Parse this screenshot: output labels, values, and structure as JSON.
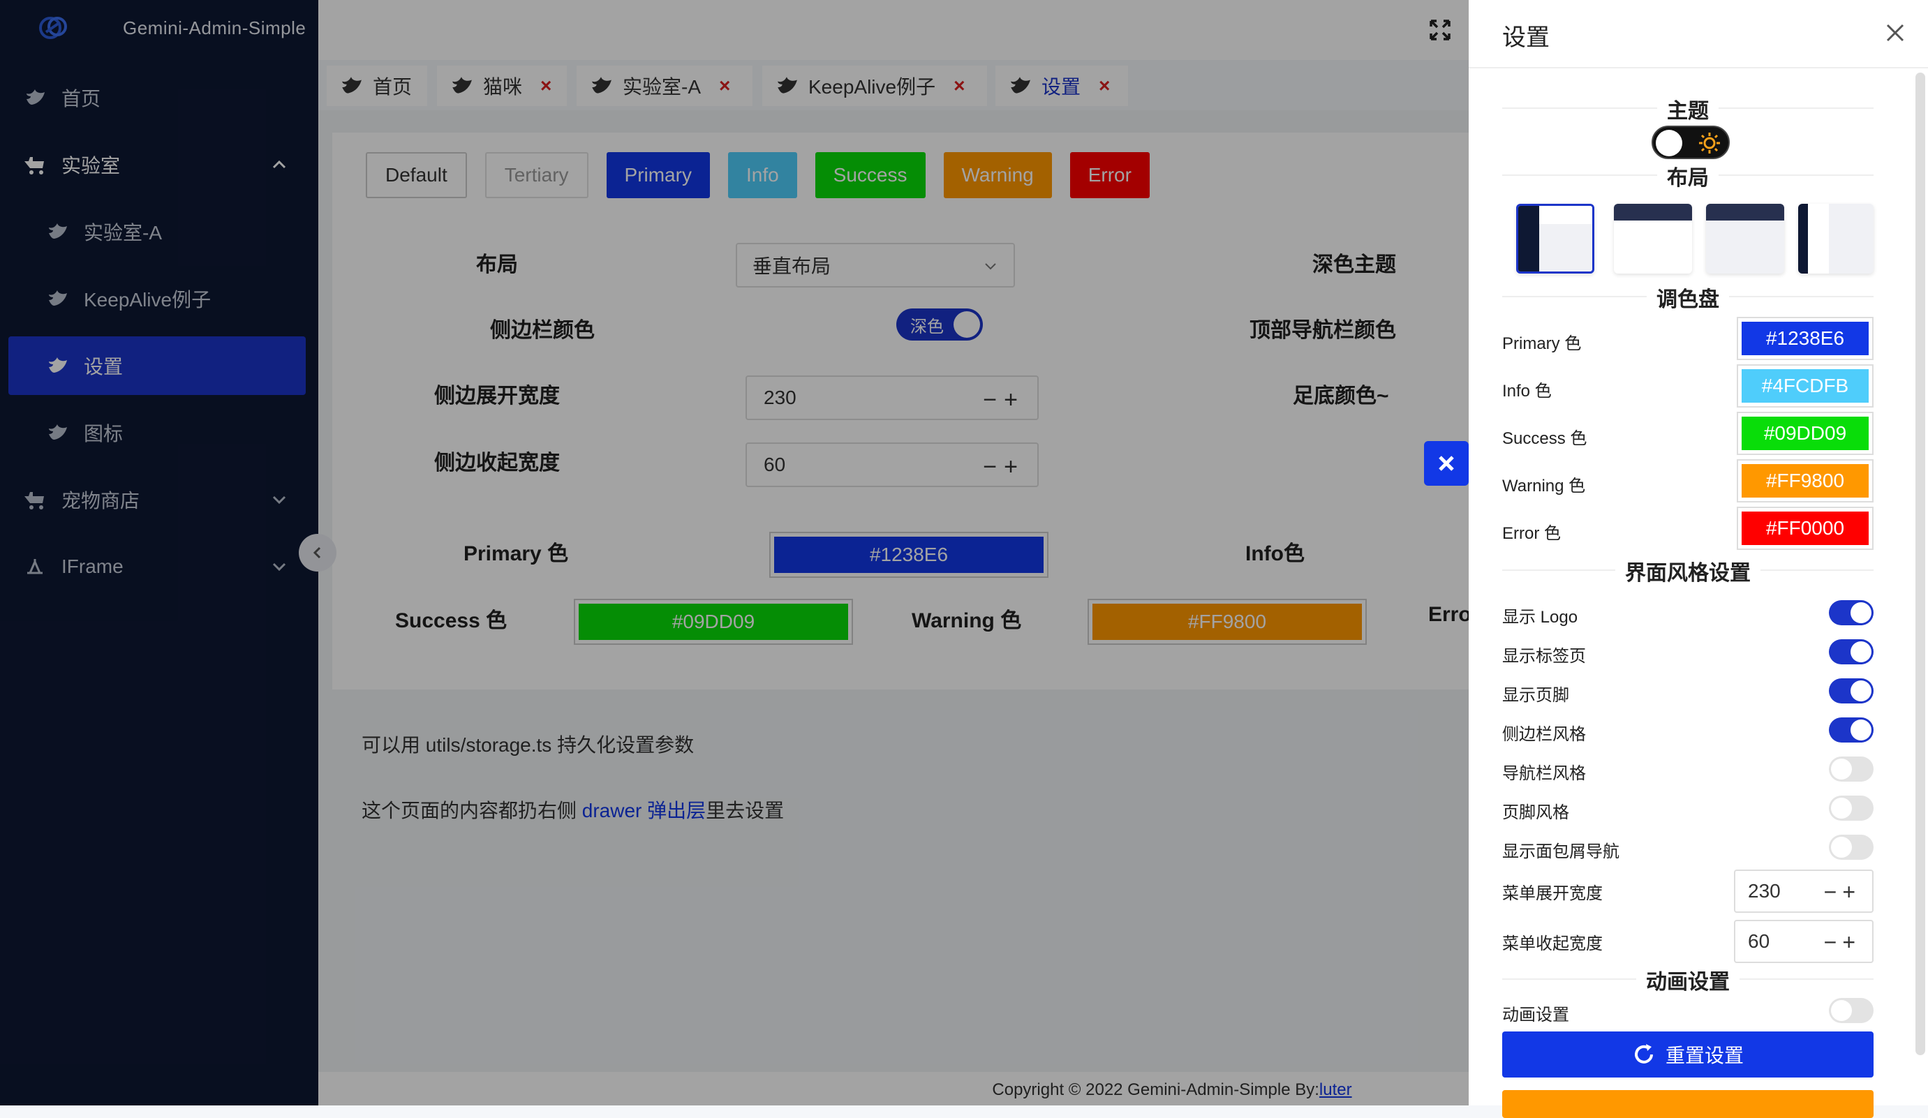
{
  "app": {
    "title": "Gemini-Admin-Simple"
  },
  "sidebar": {
    "items": [
      {
        "label": "首页"
      },
      {
        "label": "实验室"
      },
      {
        "label": "实验室-A"
      },
      {
        "label": "KeepAlive例子"
      },
      {
        "label": "设置"
      },
      {
        "label": "图标"
      },
      {
        "label": "宠物商店"
      },
      {
        "label": "IFrame"
      }
    ]
  },
  "tabs": [
    {
      "label": "首页"
    },
    {
      "label": "猫咪",
      "close": "×"
    },
    {
      "label": "实验室-A",
      "close": "×"
    },
    {
      "label": "KeepAlive例子",
      "close": "×"
    },
    {
      "label": "设置",
      "close": "×"
    }
  ],
  "buttons": [
    "Default",
    "Tertiary",
    "Primary",
    "Info",
    "Success",
    "Warning",
    "Error"
  ],
  "form": {
    "layout_label": "布局",
    "layout_value": "垂直布局",
    "dark_theme_label": "深色主题",
    "sidebar_color_label": "侧边栏颜色",
    "sidebar_color_switch": "深色",
    "topnav_color_label": "顶部导航栏颜色",
    "sidebar_expand_label": "侧边展开宽度",
    "sidebar_expand_value": "230",
    "footer_color_label": "足底颜色~",
    "sidebar_collapse_label": "侧边收起宽度",
    "sidebar_collapse_value": "60"
  },
  "colors": {
    "primary_label": "Primary 色",
    "primary_value": "#1238E6",
    "info_label": "Info色",
    "success_label": "Success 色",
    "success_value": "#09DD09",
    "warning_label": "Warning 色",
    "warning_value": "#FF9800",
    "error_label_partial": "Erro"
  },
  "notes": {
    "line1": "可以用 utils/storage.ts 持久化设置参数",
    "line2_prefix": "这个页面的内容都扔右侧 ",
    "line2_link": "drawer 弹出层",
    "line2_suffix": "里去设置"
  },
  "footer": {
    "text": "Copyright © 2022 Gemini-Admin-Simple By:",
    "link": "luter"
  },
  "drawer": {
    "title": "设置",
    "section_theme": "主题",
    "section_layout": "布局",
    "section_palette": "调色盘",
    "palette": [
      {
        "label": "Primary 色",
        "value": "#1238E6",
        "color": "#1238E6"
      },
      {
        "label": "Info 色",
        "value": "#4FCDFB",
        "color": "#4FCDFB"
      },
      {
        "label": "Success 色",
        "value": "#09DD09",
        "color": "#09DD09"
      },
      {
        "label": "Warning 色",
        "value": "#FF9800",
        "color": "#FF9800"
      },
      {
        "label": "Error 色",
        "value": "#FF0000",
        "color": "#FF0000"
      }
    ],
    "section_ui": "界面风格设置",
    "ui_toggles": [
      {
        "label": "显示 Logo",
        "on": true
      },
      {
        "label": "显示标签页",
        "on": true
      },
      {
        "label": "显示页脚",
        "on": true
      },
      {
        "label": "侧边栏风格",
        "on": true
      },
      {
        "label": "导航栏风格",
        "on": false
      },
      {
        "label": "页脚风格",
        "on": false
      },
      {
        "label": "显示面包屑导航",
        "on": false
      }
    ],
    "menu_expand_label": "菜单展开宽度",
    "menu_expand_value": "230",
    "menu_collapse_label": "菜单收起宽度",
    "menu_collapse_value": "60",
    "section_anim": "动画设置",
    "anim_label": "动画设置",
    "reset_label": "重置设置"
  },
  "accent": "#1238E6"
}
